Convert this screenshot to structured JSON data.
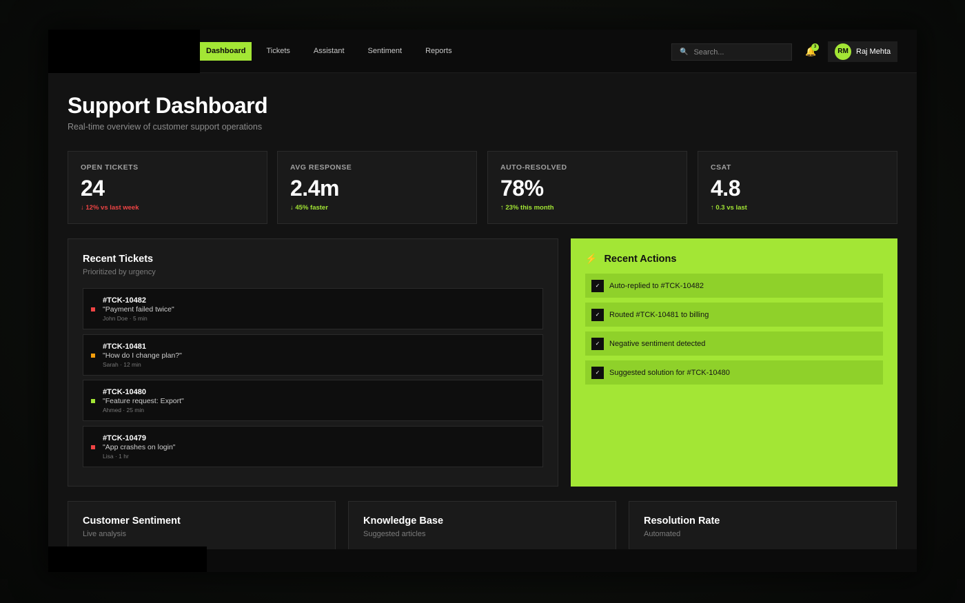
{
  "nav": {
    "items": [
      "Dashboard",
      "Tickets",
      "Assistant",
      "Sentiment",
      "Reports"
    ],
    "search_placeholder": "Search...",
    "notification_count": "3",
    "user_initials": "RM",
    "user_name": "Raj Mehta"
  },
  "header": {
    "title": "Support Dashboard",
    "subtitle": "Real-time overview of customer support operations"
  },
  "stats": [
    {
      "label": "OPEN TICKETS",
      "value": "24",
      "change": "↓ 12% vs last week",
      "trend": "red"
    },
    {
      "label": "AVG RESPONSE",
      "value": "2.4m",
      "change": "↓ 45% faster",
      "trend": "green"
    },
    {
      "label": "AUTO-RESOLVED",
      "value": "78%",
      "change": "↑ 23% this month",
      "trend": "green"
    },
    {
      "label": "CSAT",
      "value": "4.8",
      "change": "↑ 0.3 vs last",
      "trend": "green"
    }
  ],
  "tickets": {
    "title": "Recent Tickets",
    "subtitle": "Prioritized by urgency",
    "items": [
      {
        "id": "#TCK-10482",
        "text": "\"Payment failed twice\"",
        "meta": "John Doe · 5 min",
        "color": "#ef4444"
      },
      {
        "id": "#TCK-10481",
        "text": "\"How do I change plan?\"",
        "meta": "Sarah · 12 min",
        "color": "#f59e0b"
      },
      {
        "id": "#TCK-10480",
        "text": "\"Feature request: Export\"",
        "meta": "Ahmed · 25 min",
        "color": "#a3e635"
      },
      {
        "id": "#TCK-10479",
        "text": "\"App crashes on login\"",
        "meta": "Lisa · 1 hr",
        "color": "#ef4444"
      }
    ]
  },
  "actions": {
    "title": "Recent Actions",
    "icon": "bolt-icon",
    "items": [
      "Auto-replied to #TCK-10482",
      "Routed #TCK-10481 to billing",
      "Negative sentiment detected",
      "Suggested solution for #TCK-10480"
    ]
  },
  "bottom_cards": [
    {
      "title": "Customer Sentiment",
      "subtitle": "Live analysis"
    },
    {
      "title": "Knowledge Base",
      "subtitle": "Suggested articles"
    },
    {
      "title": "Resolution Rate",
      "subtitle": "Automated"
    }
  ],
  "colors": {
    "accent": "#a3e635",
    "danger": "#ef4444",
    "warning": "#f59e0b",
    "background": "#131313"
  }
}
